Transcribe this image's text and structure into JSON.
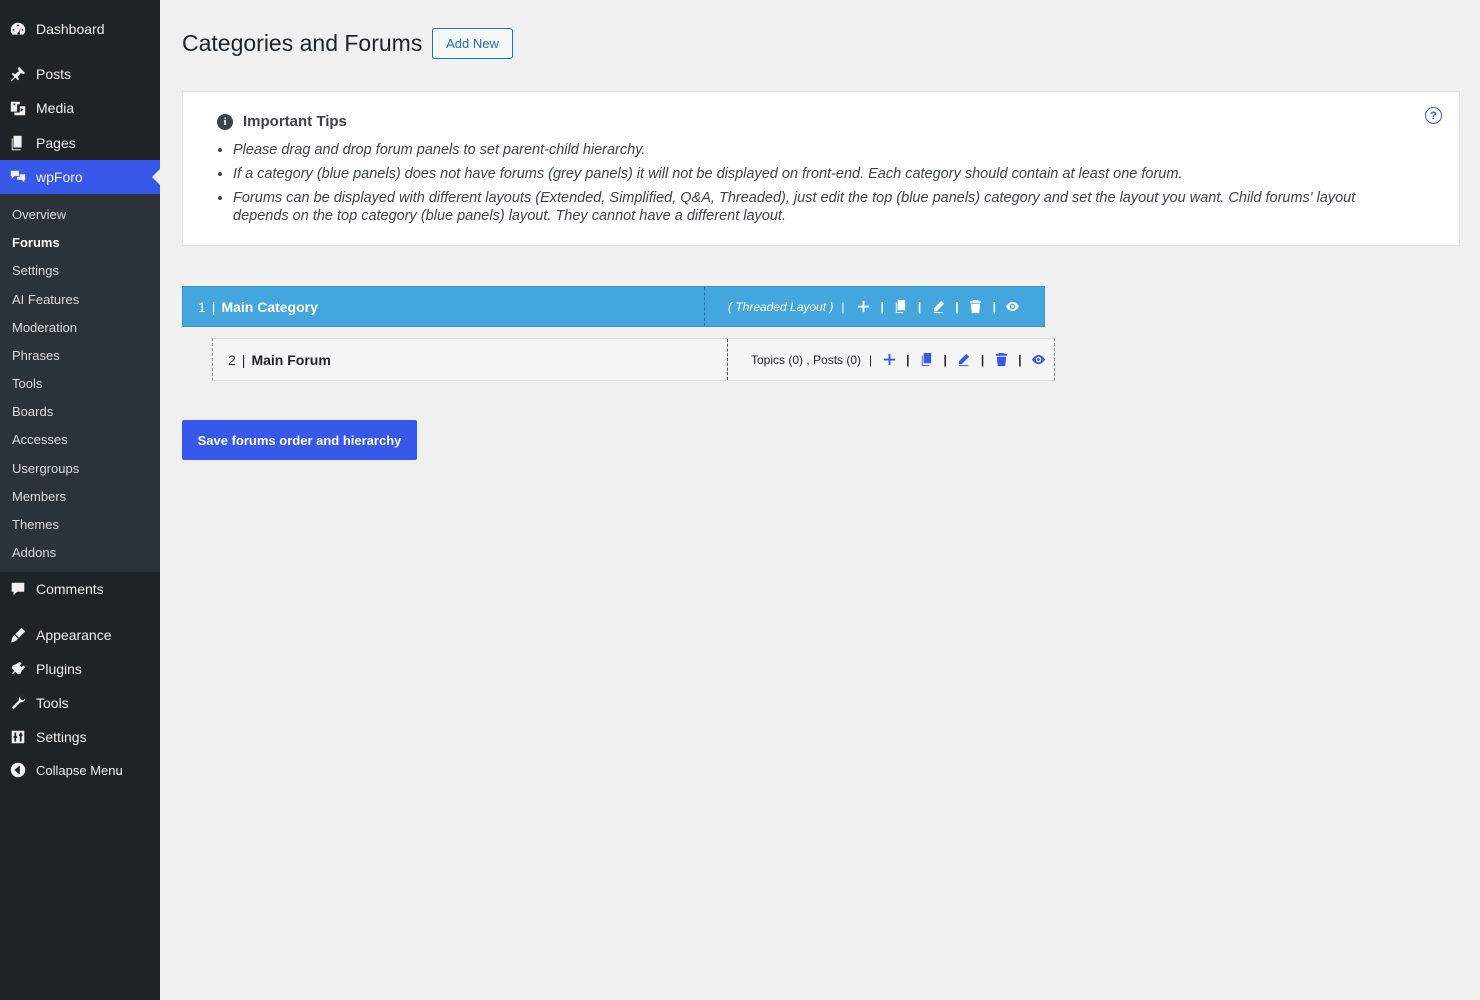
{
  "sidebar": {
    "top_items": [
      {
        "label": "Dashboard",
        "icon": "dashboard-icon"
      },
      {
        "label": "Posts",
        "icon": "pin-icon"
      },
      {
        "label": "Media",
        "icon": "media-icon"
      },
      {
        "label": "Pages",
        "icon": "pages-icon"
      },
      {
        "label": "wpForo",
        "icon": "wpforo-icon"
      }
    ],
    "submenu": [
      "Overview",
      "Forums",
      "Settings",
      "AI Features",
      "Moderation",
      "Phrases",
      "Tools",
      "Boards",
      "Accesses",
      "Usergroups",
      "Members",
      "Themes",
      "Addons"
    ],
    "active_submenu": "Forums",
    "bottom_items": [
      {
        "label": "Comments",
        "icon": "comments-icon"
      },
      {
        "label": "Appearance",
        "icon": "appearance-icon"
      },
      {
        "label": "Plugins",
        "icon": "plugins-icon"
      },
      {
        "label": "Tools",
        "icon": "wrench-icon"
      },
      {
        "label": "Settings",
        "icon": "settings-icon"
      },
      {
        "label": "Collapse Menu",
        "icon": "collapse-icon"
      }
    ]
  },
  "header": {
    "title": "Categories and Forums",
    "add_new": "Add New"
  },
  "tips": {
    "title": "Important Tips",
    "items": [
      "Please drag and drop forum panels to set parent-child hierarchy.",
      "If a category (blue panels) does not have forums (grey panels) it will not be displayed on front-end. Each category should contain at least one forum.",
      "Forums can be displayed with different layouts (Extended, Simplified, Q&A, Threaded), just edit the top (blue panels) category and set the layout you want. Child forums' layout depends on the top category (blue panels) layout. They cannot have a different layout."
    ]
  },
  "category": {
    "id": "1",
    "name": "Main Category",
    "layout": "( Threaded Layout )"
  },
  "forum": {
    "id": "2",
    "name": "Main Forum",
    "stats": "Topics (0) , Posts (0)"
  },
  "save_button": "Save forums order and hierarchy",
  "colors": {
    "accent": "#3858e9",
    "category_blue": "#43a6df",
    "sidebar_bg": "#1d2327"
  }
}
